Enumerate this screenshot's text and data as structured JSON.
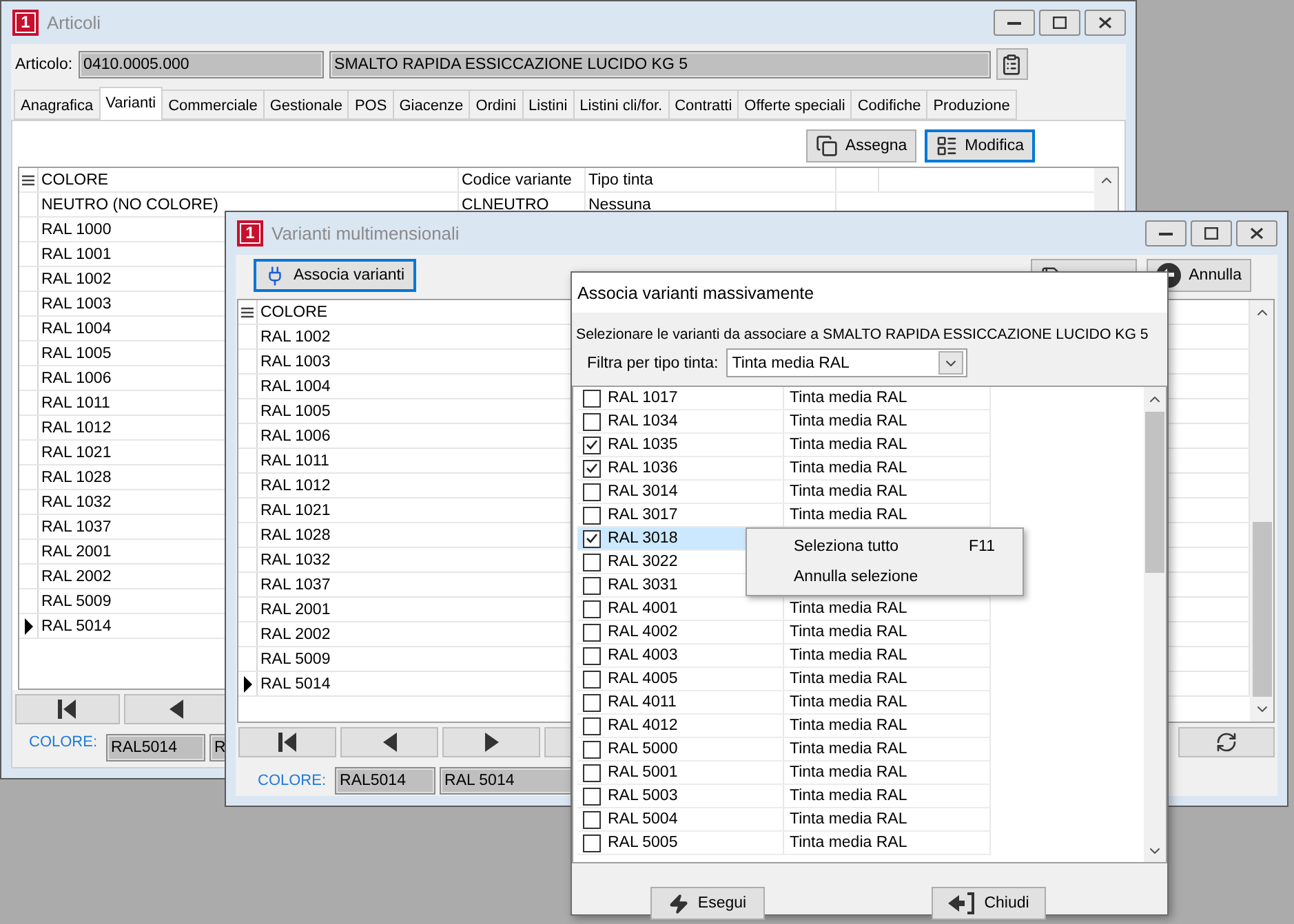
{
  "articoli_window": {
    "badge": "1",
    "title": "Articoli",
    "article_label": "Articolo:",
    "article_code": "0410.0005.000",
    "article_description": "SMALTO RAPIDA ESSICCAZIONE LUCIDO KG 5",
    "tabs": [
      {
        "label": "Anagrafica",
        "selected": false
      },
      {
        "label": "Varianti",
        "selected": true
      },
      {
        "label": "Commerciale",
        "selected": false
      },
      {
        "label": "Gestionale",
        "selected": false
      },
      {
        "label": "POS",
        "selected": false
      },
      {
        "label": "Giacenze",
        "selected": false
      },
      {
        "label": "Ordini",
        "selected": false
      },
      {
        "label": "Listini",
        "selected": false
      },
      {
        "label": "Listini cli/for.",
        "selected": false
      },
      {
        "label": "Contratti",
        "selected": false
      },
      {
        "label": "Offerte speciali",
        "selected": false
      },
      {
        "label": "Codifiche",
        "selected": false
      },
      {
        "label": "Produzione",
        "selected": false
      }
    ],
    "actions": [
      {
        "kind": "copy",
        "label": "Assegna",
        "focused": false
      },
      {
        "kind": "list",
        "label": "Modifica",
        "focused": true
      }
    ],
    "columns": [
      "COLORE",
      "Codice variante",
      "Tipo tinta"
    ],
    "rows": [
      {
        "cells": [
          "NEUTRO (NO COLORE)",
          "CLNEUTRO",
          "Nessuna"
        ],
        "current": false
      },
      {
        "cells": [
          "RAL 1000"
        ],
        "current": false
      },
      {
        "cells": [
          "RAL 1001"
        ],
        "current": false
      },
      {
        "cells": [
          "RAL 1002"
        ],
        "current": false
      },
      {
        "cells": [
          "RAL 1003"
        ],
        "current": false
      },
      {
        "cells": [
          "RAL 1004"
        ],
        "current": false
      },
      {
        "cells": [
          "RAL 1005"
        ],
        "current": false
      },
      {
        "cells": [
          "RAL 1006"
        ],
        "current": false
      },
      {
        "cells": [
          "RAL 1011"
        ],
        "current": false
      },
      {
        "cells": [
          "RAL 1012"
        ],
        "current": false
      },
      {
        "cells": [
          "RAL 1021"
        ],
        "current": false
      },
      {
        "cells": [
          "RAL 1028"
        ],
        "current": false
      },
      {
        "cells": [
          "RAL 1032"
        ],
        "current": false
      },
      {
        "cells": [
          "RAL 1037"
        ],
        "current": false
      },
      {
        "cells": [
          "RAL 2001"
        ],
        "current": false
      },
      {
        "cells": [
          "RAL 2002"
        ],
        "current": false
      },
      {
        "cells": [
          "RAL 5009"
        ],
        "current": false
      },
      {
        "cells": [
          "RAL 5014"
        ],
        "current": true
      }
    ],
    "nav_buttons": [
      {
        "kind": "first"
      },
      {
        "kind": "prev"
      }
    ],
    "footer": {
      "label": "COLORE:",
      "values": [
        "RAL5014",
        "R"
      ]
    }
  },
  "varianti_window": {
    "badge": "1",
    "title": "Varianti multimensionali",
    "associate_button": {
      "label": "Associa varianti",
      "focused": true
    },
    "cancel_button": "Annulla",
    "column": "COLORE",
    "rows": [
      {
        "name": "RAL 1002",
        "current": false
      },
      {
        "name": "RAL 1003",
        "current": false
      },
      {
        "name": "RAL 1004",
        "current": false
      },
      {
        "name": "RAL 1005",
        "current": false
      },
      {
        "name": "RAL 1006",
        "current": false
      },
      {
        "name": "RAL 1011",
        "current": false
      },
      {
        "name": "RAL 1012",
        "current": false
      },
      {
        "name": "RAL 1021",
        "current": false
      },
      {
        "name": "RAL 1028",
        "current": false
      },
      {
        "name": "RAL 1032",
        "current": false
      },
      {
        "name": "RAL 1037",
        "current": false
      },
      {
        "name": "RAL 2001",
        "current": false
      },
      {
        "name": "RAL 2002",
        "current": false
      },
      {
        "name": "RAL 5009",
        "current": false
      },
      {
        "name": "RAL 5014",
        "current": true
      }
    ],
    "nav_buttons": [
      {
        "kind": "first"
      },
      {
        "kind": "prev"
      },
      {
        "kind": "next"
      },
      {
        "kind": "blank"
      }
    ],
    "footer": {
      "label": "COLORE:",
      "values": [
        "RAL5014",
        "RAL 5014"
      ]
    }
  },
  "associa_dialog": {
    "title": "Associa varianti massivamente",
    "instruction": "Selezionare le varianti da associare a SMALTO RAPIDA ESSICCAZIONE LUCIDO KG 5",
    "filter_label": "Filtra per tipo tinta:",
    "filter_value": "Tinta media RAL",
    "rows": [
      {
        "name": "RAL 1017",
        "type": "Tinta media RAL",
        "checked": false,
        "selected": false
      },
      {
        "name": "RAL 1034",
        "type": "Tinta media RAL",
        "checked": false,
        "selected": false
      },
      {
        "name": "RAL 1035",
        "type": "Tinta media RAL",
        "checked": true,
        "selected": false
      },
      {
        "name": "RAL 1036",
        "type": "Tinta media RAL",
        "checked": true,
        "selected": false
      },
      {
        "name": "RAL 3014",
        "type": "Tinta media RAL",
        "checked": false,
        "selected": false
      },
      {
        "name": "RAL 3017",
        "type": "Tinta media RAL",
        "checked": false,
        "selected": false
      },
      {
        "name": "RAL 3018",
        "checked": true,
        "selected": true
      },
      {
        "name": "RAL 3022",
        "checked": false,
        "selected": false
      },
      {
        "name": "RAL 3031",
        "checked": false,
        "selected": false
      },
      {
        "name": "RAL 4001",
        "type": "Tinta media RAL",
        "checked": false,
        "selected": false
      },
      {
        "name": "RAL 4002",
        "type": "Tinta media RAL",
        "checked": false,
        "selected": false
      },
      {
        "name": "RAL 4003",
        "type": "Tinta media RAL",
        "checked": false,
        "selected": false
      },
      {
        "name": "RAL 4005",
        "type": "Tinta media RAL",
        "checked": false,
        "selected": false
      },
      {
        "name": "RAL 4011",
        "type": "Tinta media RAL",
        "checked": false,
        "selected": false
      },
      {
        "name": "RAL 4012",
        "type": "Tinta media RAL",
        "checked": false,
        "selected": false
      },
      {
        "name": "RAL 5000",
        "type": "Tinta media RAL",
        "checked": false,
        "selected": false
      },
      {
        "name": "RAL 5001",
        "type": "Tinta media RAL",
        "checked": false,
        "selected": false
      },
      {
        "name": "RAL 5003",
        "type": "Tinta media RAL",
        "checked": false,
        "selected": false
      },
      {
        "name": "RAL 5004",
        "type": "Tinta media RAL",
        "checked": false,
        "selected": false
      },
      {
        "name": "RAL 5005",
        "type": "Tinta media RAL",
        "checked": false,
        "selected": false
      }
    ],
    "buttons": [
      {
        "kind": "run",
        "label": "Esegui"
      },
      {
        "kind": "close",
        "label": "Chiudi"
      }
    ]
  },
  "context_menu": {
    "items": [
      {
        "label": "Seleziona tutto",
        "shortcut": "F11"
      },
      {
        "label": "Annulla selezione"
      }
    ]
  }
}
